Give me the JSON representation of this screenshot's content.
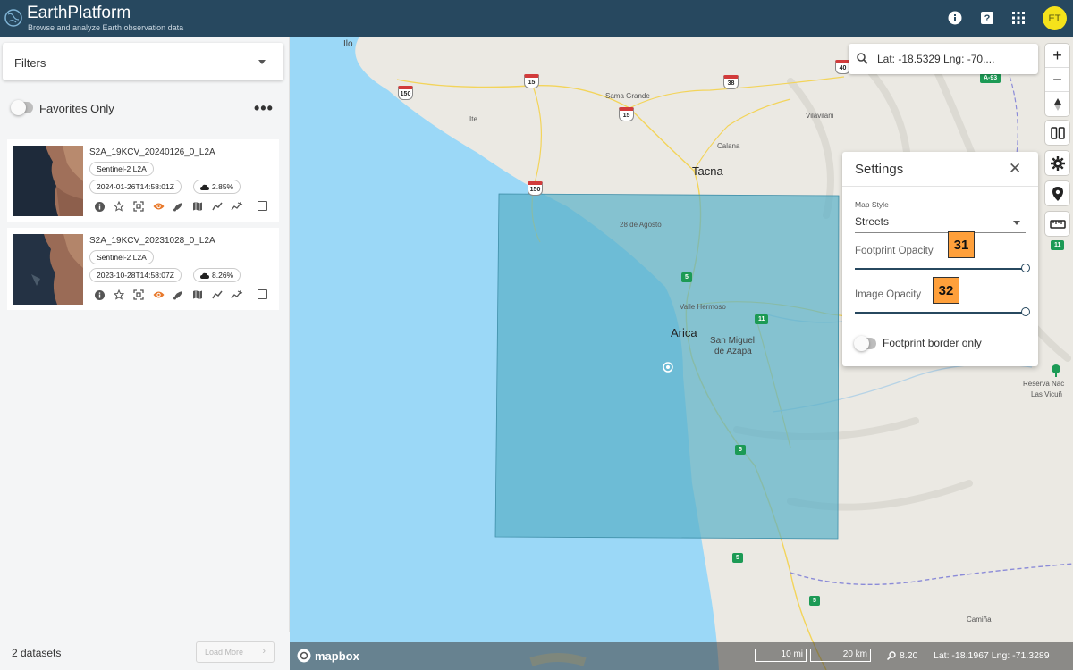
{
  "app": {
    "title": "EarthPlatform",
    "subtitle": "Browse and analyze Earth observation data",
    "user_initials": "ET"
  },
  "header_icons": [
    "info-icon",
    "help-icon",
    "apps-grid-icon"
  ],
  "sidebar": {
    "filters_label": "Filters",
    "favorites_label": "Favorites Only",
    "favorites_on": false,
    "datasets": [
      {
        "name": "S2A_19KCV_20240126_0_L2A",
        "collection": "Sentinel-2 L2A",
        "datetime": "2024-01-26T14:58:01Z",
        "cloud_cover": "2.85%",
        "visible": true
      },
      {
        "name": "S2A_19KCV_20231028_0_L2A",
        "collection": "Sentinel-2 L2A",
        "datetime": "2023-10-28T14:58:07Z",
        "cloud_cover": "8.26%",
        "visible": true
      }
    ],
    "dataset_count": "2 datasets",
    "load_more_label": "Load More"
  },
  "map": {
    "search_text": "Lat: -18.5329 Lng: -70....",
    "labels": {
      "ilo": "Ilo",
      "ite": "Ite",
      "sama_grande": "Sama Grande",
      "calana": "Calana",
      "tacna": "Tacna",
      "vilavilani": "Vilavilani",
      "agosto": "28 de Agosto",
      "valle_hermoso": "Valle Hermoso",
      "arica": "Arica",
      "san_miguel": "San Miguel",
      "de_azapa": "de Azapa",
      "reserva": "Reserva Nac",
      "las_vicunas": "Las Vicuñ",
      "camina": "Camiña"
    },
    "shields": {
      "s150d_a": "150",
      "s15_a": "15",
      "s38": "38",
      "s40": "40",
      "s15_b": "15",
      "s150d_b": "150",
      "a93": "A-93",
      "g5_a": "5",
      "g11_a": "11",
      "g11_b": "11",
      "g5_b": "5",
      "g5_c": "5",
      "g5_d": "5"
    },
    "scale_mi": "10 mi",
    "scale_km": "20 km",
    "zoom": "8.20",
    "cursor_coords": "Lat: -18.1967  Lng: -71.3289",
    "attribution": "mapbox"
  },
  "settings": {
    "title": "Settings",
    "map_style_label": "Map Style",
    "map_style_value": "Streets",
    "footprint_opacity_label": "Footprint Opacity",
    "footprint_opacity": 1.0,
    "image_opacity_label": "Image Opacity",
    "image_opacity": 1.0,
    "border_only_label": "Footprint border only",
    "border_only_on": false,
    "badge_footprint": "31",
    "badge_image": "32"
  },
  "colors": {
    "header": "#27485f",
    "accent_orange": "#e8782a",
    "footprint_fill": "#5ab0c8",
    "ocean": "#9bd8f7",
    "badge": "#ffa03b"
  }
}
